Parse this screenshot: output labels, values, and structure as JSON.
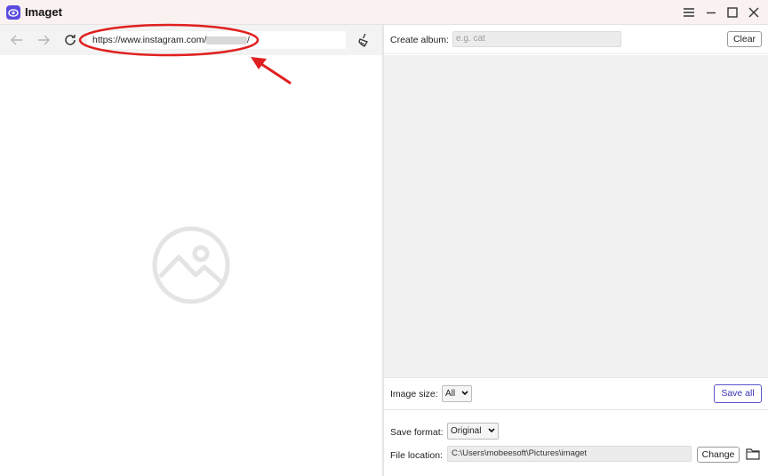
{
  "app": {
    "title": "Imaget",
    "accent_color": "#5b4be0",
    "annotation_color": "#e02020"
  },
  "window_controls": {
    "menu_icon": "hamburger-icon",
    "minimize_icon": "minimize-icon",
    "maximize_icon": "maximize-icon",
    "close_icon": "close-icon"
  },
  "browser": {
    "url": "https://www.instagram.com/",
    "url_tail": "/",
    "nav_icons": [
      "back-arrow-icon",
      "forward-arrow-icon",
      "reload-icon",
      "clean-broom-icon"
    ],
    "placeholder_icon": "image-placeholder-icon"
  },
  "album": {
    "label": "Create album:",
    "placeholder": "e.g. cat",
    "clear_label": "Clear"
  },
  "image_size": {
    "label": "Image size:",
    "selected": "All",
    "save_all_label": "Save all"
  },
  "save_format": {
    "label": "Save format:",
    "selected": "Original"
  },
  "file_location": {
    "label": "File location:",
    "path": "C:\\Users\\mobeesoft\\Pictures\\imaget",
    "change_label": "Change",
    "folder_icon": "folder-icon"
  }
}
